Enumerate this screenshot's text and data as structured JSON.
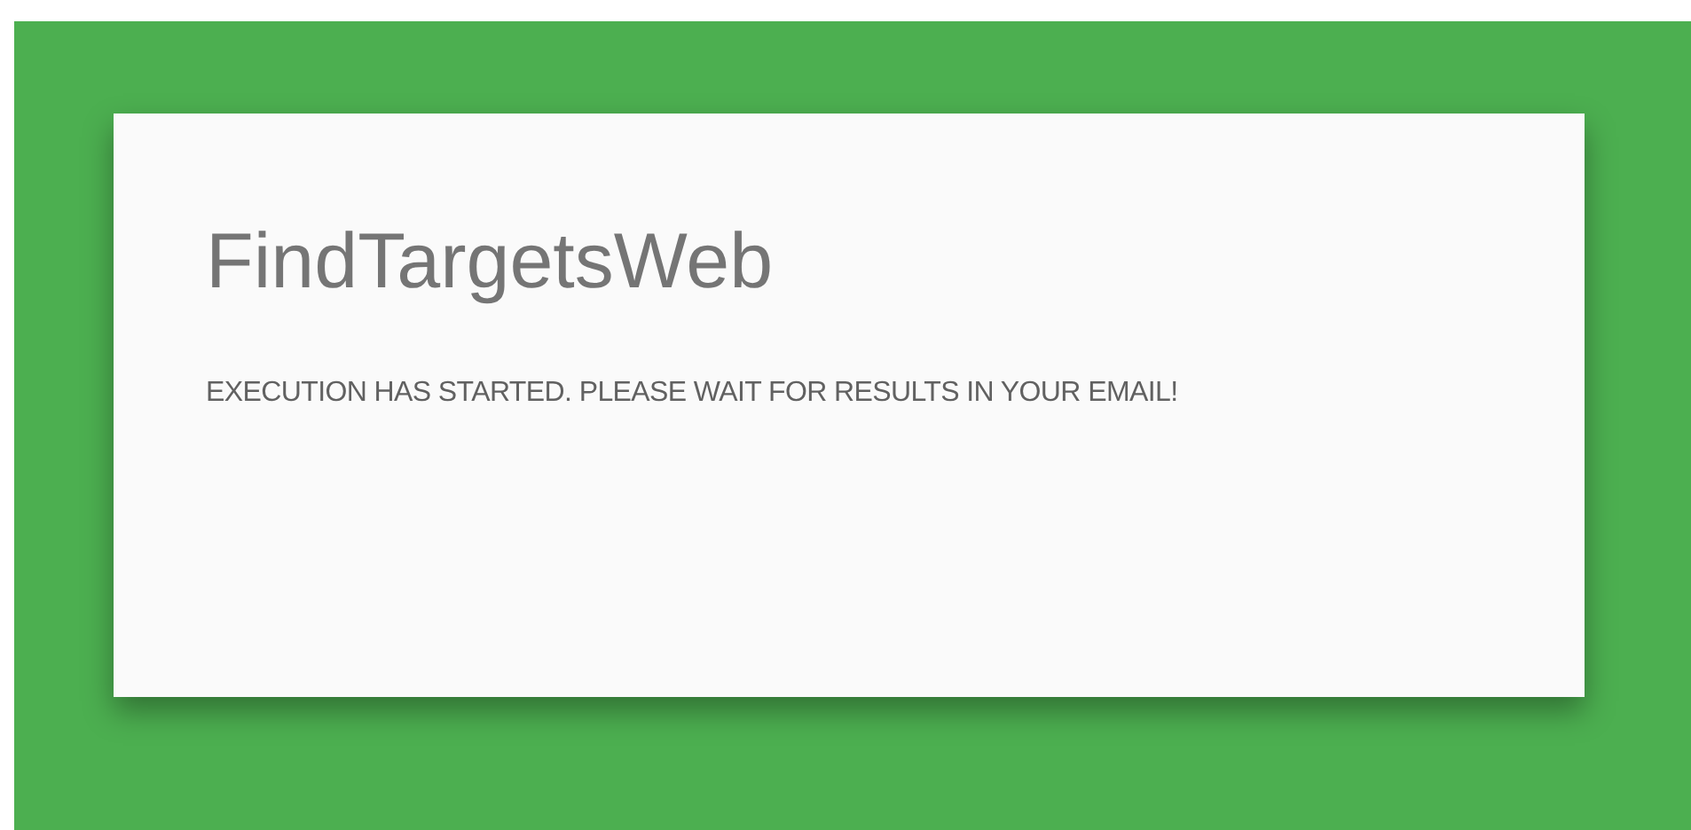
{
  "card": {
    "title": "FindTargetsWeb",
    "message": "EXECUTION HAS STARTED. PLEASE WAIT FOR RESULTS IN YOUR EMAIL!"
  }
}
